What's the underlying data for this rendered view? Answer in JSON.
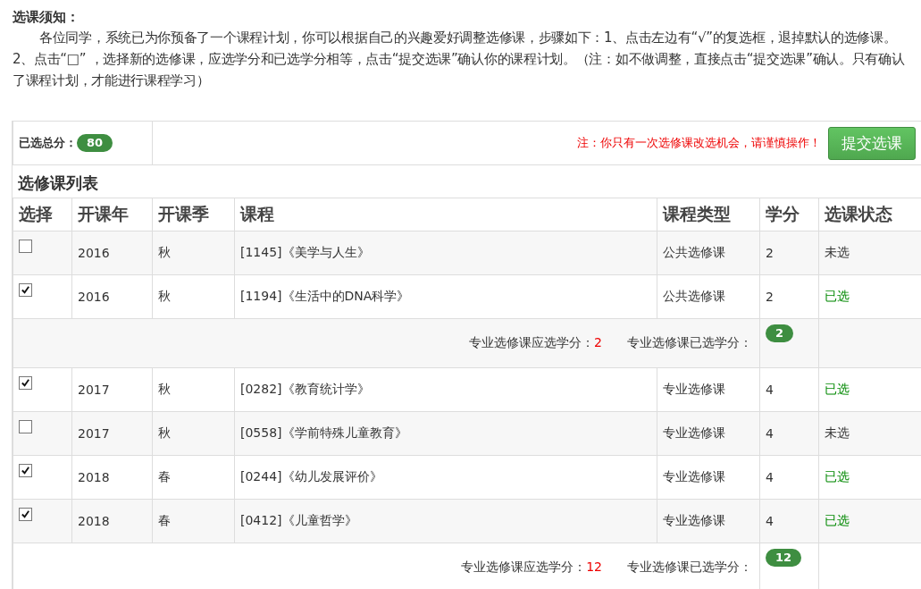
{
  "notice": {
    "title": "选课须知：",
    "paragraph": "各位同学，系统已为你预备了一个课程计划，你可以根据自己的兴趣爱好调整选修课，步骤如下：1、点击左边有“√”的复选框，退掉默认的选修课。2、点击“□” ，选择新的选修课，应选学分和已选学分相等，点击“提交选课”确认你的课程计划。（注：如不做调整，直接点击“提交选课”确认。只有确认了课程计划，才能进行课程学习）"
  },
  "summary": {
    "label": "已选总分：",
    "total": "80",
    "warning": "注：你只有一次选修课改选机会，请谨慎操作！",
    "submit_button": "提交选课"
  },
  "list_title": "选修课列表",
  "columns": [
    "选择",
    "开课年",
    "开课季",
    "课程",
    "课程类型",
    "学分",
    "选课状态"
  ],
  "rows": [
    {
      "kind": "course",
      "checked": false,
      "year": "2016",
      "season": "秋",
      "course": "[1145]《美学与人生》",
      "type": "公共选修课",
      "credits": "2",
      "status": "未选"
    },
    {
      "kind": "course",
      "checked": true,
      "year": "2016",
      "season": "秋",
      "course": "[1194]《生活中的DNA科学》",
      "type": "公共选修课",
      "credits": "2",
      "status": "已选"
    },
    {
      "kind": "subtotal",
      "required_label": "专业选修课应选学分：",
      "required_value": "2",
      "selected_label": "专业选修课已选学分：",
      "selected_value": "2"
    },
    {
      "kind": "course",
      "checked": true,
      "year": "2017",
      "season": "秋",
      "course": "[0282]《教育统计学》",
      "type": "专业选修课",
      "credits": "4",
      "status": "已选"
    },
    {
      "kind": "course",
      "checked": false,
      "year": "2017",
      "season": "秋",
      "course": "[0558]《学前特殊儿童教育》",
      "type": "专业选修课",
      "credits": "4",
      "status": "未选"
    },
    {
      "kind": "course",
      "checked": true,
      "year": "2018",
      "season": "春",
      "course": "[0244]《幼儿发展评价》",
      "type": "专业选修课",
      "credits": "4",
      "status": "已选"
    },
    {
      "kind": "course",
      "checked": true,
      "year": "2018",
      "season": "春",
      "course": "[0412]《儿童哲学》",
      "type": "专业选修课",
      "credits": "4",
      "status": "已选"
    },
    {
      "kind": "subtotal",
      "required_label": "专业选修课应选学分：",
      "required_value": "12",
      "selected_label": "专业选修课已选学分：",
      "selected_value": "12"
    }
  ]
}
